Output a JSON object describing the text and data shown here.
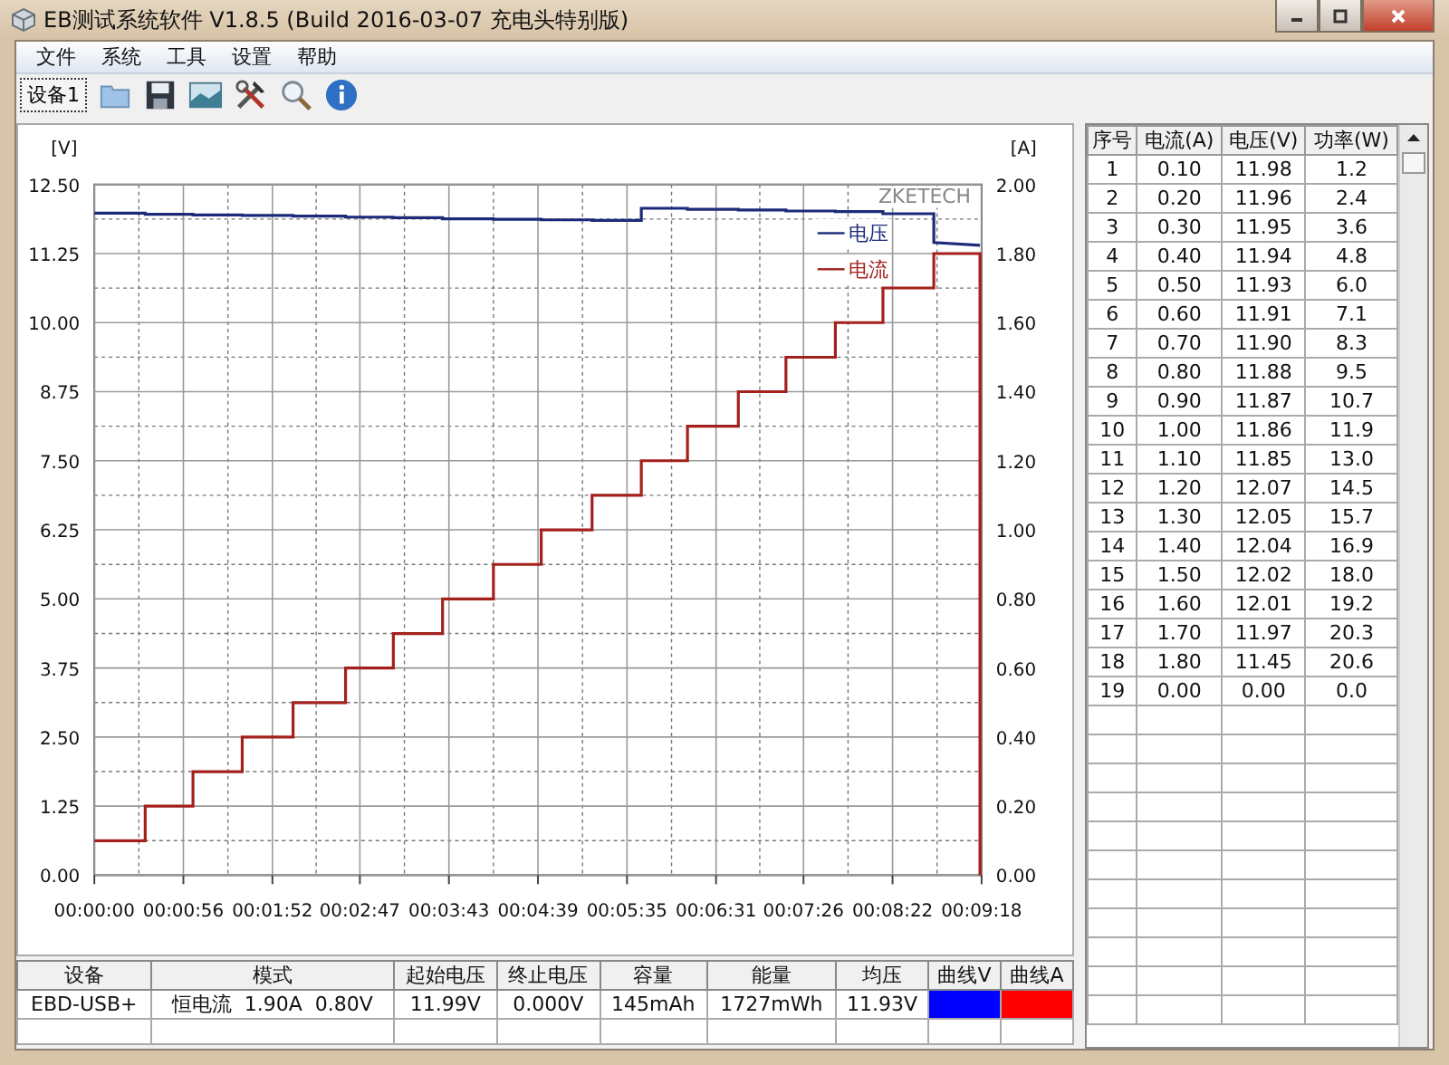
{
  "window": {
    "title": "EB测试系统软件 V1.8.5 (Build 2016-03-07 充电头特别版)"
  },
  "menu": [
    "文件",
    "系统",
    "工具",
    "设置",
    "帮助"
  ],
  "toolbar": {
    "device_button": "设备1"
  },
  "chart": {
    "brand": "ZKETECH",
    "y2label": "[A]",
    "chart_data": {
      "type": "line",
      "ylabel": "[V]",
      "grid": true,
      "legend": true,
      "y2lim": [
        0,
        2
      ],
      "y2ticks": [
        {
          "value": 0,
          "label": "0.00"
        },
        {
          "value": 0.2,
          "label": "0.20"
        },
        {
          "value": 0.4,
          "label": "0.40"
        },
        {
          "value": 0.6,
          "label": "0.60"
        },
        {
          "value": 0.8,
          "label": "0.80"
        },
        {
          "value": 1,
          "label": "1.00"
        },
        {
          "value": 1.2,
          "label": "1.20"
        },
        {
          "value": 1.4,
          "label": "1.40"
        },
        {
          "value": 1.6,
          "label": "1.60"
        },
        {
          "value": 1.8,
          "label": "1.80"
        },
        {
          "value": 2,
          "label": "2.00"
        }
      ],
      "x": [
        0,
        32,
        32,
        62,
        62,
        93,
        93,
        125,
        125,
        158,
        158,
        188,
        188,
        219,
        219,
        251,
        251,
        281,
        281,
        313,
        313,
        344,
        344,
        373,
        373,
        405,
        405,
        435,
        435,
        466,
        466,
        496,
        496,
        528,
        528,
        557,
        557
      ],
      "series": [
        {
          "name": "电压",
          "color": "#1c2a7a",
          "values": [
            11.98,
            11.98,
            11.96,
            11.96,
            11.95,
            11.95,
            11.94,
            11.94,
            11.93,
            11.93,
            11.91,
            11.91,
            11.9,
            11.9,
            11.88,
            11.88,
            11.87,
            11.87,
            11.86,
            11.86,
            11.85,
            11.85,
            12.07,
            12.07,
            12.05,
            12.05,
            12.04,
            12.04,
            12.02,
            12.02,
            12.01,
            12.01,
            11.97,
            11.97,
            11.45,
            11.4,
            null
          ]
        },
        {
          "name": "电流",
          "color": "#a3201c",
          "axis": "y2",
          "values": [
            0.1,
            0.1,
            0.2,
            0.2,
            0.3,
            0.3,
            0.4,
            0.4,
            0.5,
            0.5,
            0.6,
            0.6,
            0.7,
            0.7,
            0.8,
            0.8,
            0.9,
            0.9,
            1.0,
            1.0,
            1.1,
            1.1,
            1.2,
            1.2,
            1.3,
            1.3,
            1.4,
            1.4,
            1.5,
            1.5,
            1.6,
            1.6,
            1.7,
            1.7,
            1.8,
            1.8,
            0.0
          ]
        }
      ],
      "xlim": [
        0,
        558
      ],
      "ylim": [
        0,
        12.5
      ],
      "xticks": [
        {
          "value": 0,
          "label": "00:00:00"
        },
        {
          "value": 56,
          "label": "00:00:56"
        },
        {
          "value": 112,
          "label": "00:01:52"
        },
        {
          "value": 167,
          "label": "00:02:47"
        },
        {
          "value": 223,
          "label": "00:03:43"
        },
        {
          "value": 279,
          "label": "00:04:39"
        },
        {
          "value": 335,
          "label": "00:05:35"
        },
        {
          "value": 391,
          "label": "00:06:31"
        },
        {
          "value": 446,
          "label": "00:07:26"
        },
        {
          "value": 502,
          "label": "00:08:22"
        },
        {
          "value": 558,
          "label": "00:09:18"
        }
      ],
      "yticks": [
        {
          "value": 0,
          "label": "0.00"
        },
        {
          "value": 1.25,
          "label": "1.25"
        },
        {
          "value": 2.5,
          "label": "2.50"
        },
        {
          "value": 3.75,
          "label": "3.75"
        },
        {
          "value": 5,
          "label": "5.00"
        },
        {
          "value": 6.25,
          "label": "6.25"
        },
        {
          "value": 7.5,
          "label": "7.50"
        },
        {
          "value": 8.75,
          "label": "8.75"
        },
        {
          "value": 10,
          "label": "10.00"
        },
        {
          "value": 11.25,
          "label": "11.25"
        },
        {
          "value": 12.5,
          "label": "12.50"
        }
      ]
    }
  },
  "info_table": {
    "columns": [
      "设备",
      "模式",
      "起始电压",
      "终止电压",
      "容量",
      "能量",
      "均压",
      "曲线V",
      "曲线A"
    ],
    "rows": [
      [
        {
          "kind": "text",
          "text": "EBD-USB+"
        },
        {
          "kind": "text",
          "text": "恒电流  1.90A  0.80V"
        },
        {
          "kind": "text",
          "text": "11.99V"
        },
        {
          "kind": "text",
          "text": "0.000V"
        },
        {
          "kind": "text",
          "text": "145mAh"
        },
        {
          "kind": "text",
          "text": "1727mWh"
        },
        {
          "kind": "text",
          "text": "11.93V"
        },
        {
          "kind": "swatch",
          "color": "#0000ff"
        },
        {
          "kind": "swatch",
          "color": "#ff0000"
        }
      ]
    ]
  },
  "data_table": {
    "columns": [
      "序号",
      "电流(A)",
      "电压(V)",
      "功率(W)"
    ],
    "rows": [
      [
        "1",
        "0.10",
        "11.98",
        "1.2"
      ],
      [
        "2",
        "0.20",
        "11.96",
        "2.4"
      ],
      [
        "3",
        "0.30",
        "11.95",
        "3.6"
      ],
      [
        "4",
        "0.40",
        "11.94",
        "4.8"
      ],
      [
        "5",
        "0.50",
        "11.93",
        "6.0"
      ],
      [
        "6",
        "0.60",
        "11.91",
        "7.1"
      ],
      [
        "7",
        "0.70",
        "11.90",
        "8.3"
      ],
      [
        "8",
        "0.80",
        "11.88",
        "9.5"
      ],
      [
        "9",
        "0.90",
        "11.87",
        "10.7"
      ],
      [
        "10",
        "1.00",
        "11.86",
        "11.9"
      ],
      [
        "11",
        "1.10",
        "11.85",
        "13.0"
      ],
      [
        "12",
        "1.20",
        "12.07",
        "14.5"
      ],
      [
        "13",
        "1.30",
        "12.05",
        "15.7"
      ],
      [
        "14",
        "1.40",
        "12.04",
        "16.9"
      ],
      [
        "15",
        "1.50",
        "12.02",
        "18.0"
      ],
      [
        "16",
        "1.60",
        "12.01",
        "19.2"
      ],
      [
        "17",
        "1.70",
        "11.97",
        "20.3"
      ],
      [
        "18",
        "1.80",
        "11.45",
        "20.6"
      ],
      [
        "19",
        "0.00",
        "0.00",
        "0.0"
      ]
    ]
  }
}
